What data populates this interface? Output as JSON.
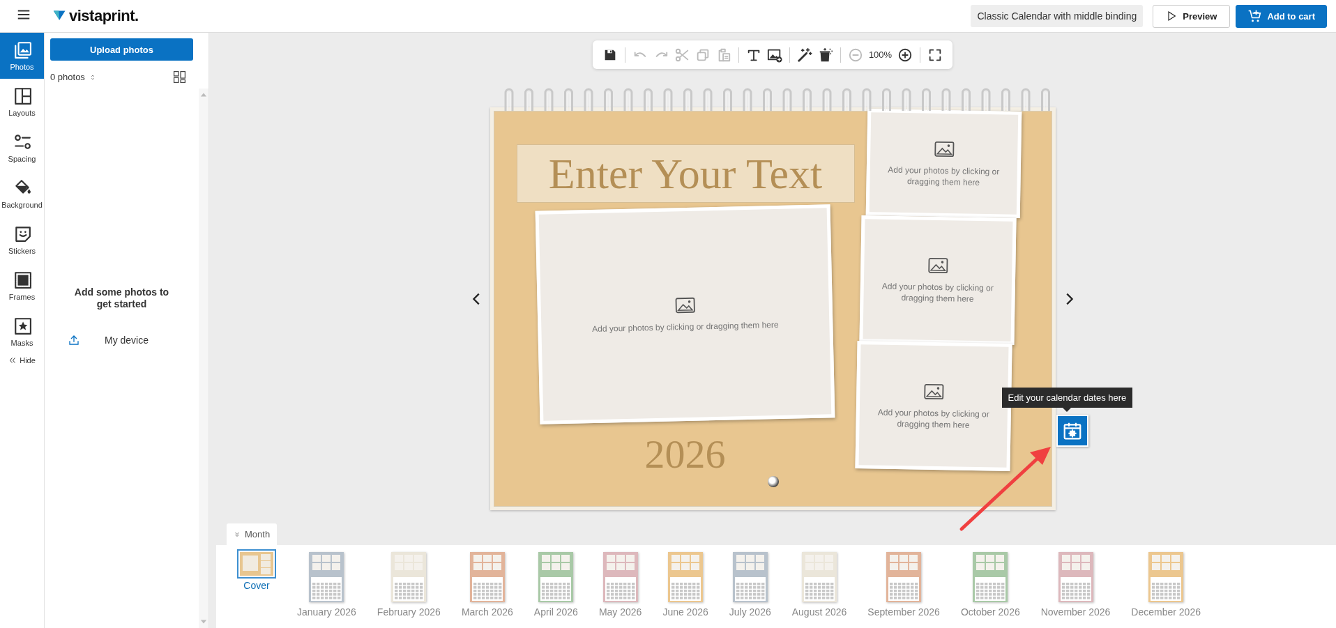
{
  "header": {
    "logo": "vistaprint.",
    "product_name": "Classic Calendar with middle binding",
    "buttons": [
      {
        "label": "Preview",
        "kind": "secondary"
      },
      {
        "label": "Add to cart",
        "kind": "primary"
      }
    ]
  },
  "rail": {
    "items": [
      {
        "label": "Photos",
        "kind": "photos",
        "selected": true
      },
      {
        "label": "Layouts",
        "kind": "layouts",
        "selected": false
      },
      {
        "label": "Spacing",
        "kind": "spacing",
        "selected": false
      },
      {
        "label": "Background",
        "kind": "background",
        "selected": false
      },
      {
        "label": "Stickers",
        "kind": "stickers",
        "selected": false
      },
      {
        "label": "Frames",
        "kind": "frames",
        "selected": false
      },
      {
        "label": "Masks",
        "kind": "masks",
        "selected": false
      }
    ],
    "hide": "Hide"
  },
  "panel": {
    "upload_button": "Upload photos",
    "photo_count": "0 photos",
    "empty_message": "Add some photos to get started",
    "source": "My device"
  },
  "toolbar": {
    "items": [
      {
        "kind": "save",
        "disabled": false
      },
      {
        "kind": "separator"
      },
      {
        "kind": "undo",
        "disabled": true
      },
      {
        "kind": "redo",
        "disabled": true
      },
      {
        "kind": "cut",
        "disabled": true
      },
      {
        "kind": "copy",
        "disabled": true
      },
      {
        "kind": "paste",
        "disabled": true
      },
      {
        "kind": "separator"
      },
      {
        "kind": "text",
        "disabled": false
      },
      {
        "kind": "add-image",
        "disabled": false
      },
      {
        "kind": "separator"
      },
      {
        "kind": "magic",
        "disabled": false
      },
      {
        "kind": "delete",
        "disabled": false
      },
      {
        "kind": "separator"
      },
      {
        "kind": "zoom-out",
        "disabled": true
      },
      {
        "kind": "zoom-level",
        "label": "100%"
      },
      {
        "kind": "zoom-in",
        "disabled": false
      },
      {
        "kind": "separator"
      },
      {
        "kind": "fullscreen",
        "disabled": false
      }
    ]
  },
  "canvas": {
    "title_placeholder": "Enter Your Text",
    "year": "2026",
    "photo_slots": [
      {
        "text": "Add your photos by clicking or dragging them here"
      },
      {
        "text": "Add your photos by clicking or dragging them here"
      },
      {
        "text": "Add your photos by clicking or dragging them here"
      },
      {
        "text": "Add your photos by clicking or dragging them here"
      }
    ],
    "tooltip": "Edit your calendar dates here"
  },
  "pages": {
    "tab": "Month",
    "items": [
      {
        "label": "Cover",
        "selected": true,
        "kind": "cover",
        "color": "#e8c690"
      },
      {
        "label": "January 2026",
        "selected": false,
        "kind": "month",
        "color": "#b8c2cc"
      },
      {
        "label": "February 2026",
        "selected": false,
        "kind": "month",
        "color": "#ebe6da"
      },
      {
        "label": "March 2026",
        "selected": false,
        "kind": "month",
        "color": "#e2b49a"
      },
      {
        "label": "April 2026",
        "selected": false,
        "kind": "month",
        "color": "#a9c9a7"
      },
      {
        "label": "May 2026",
        "selected": false,
        "kind": "month",
        "color": "#ddb8bc"
      },
      {
        "label": "June 2026",
        "selected": false,
        "kind": "month",
        "color": "#ecc78f"
      },
      {
        "label": "July 2026",
        "selected": false,
        "kind": "month",
        "color": "#b8c2cc"
      },
      {
        "label": "August 2026",
        "selected": false,
        "kind": "month",
        "color": "#ebe6da"
      },
      {
        "label": "September 2026",
        "selected": false,
        "kind": "month",
        "color": "#e2b49a"
      },
      {
        "label": "October 2026",
        "selected": false,
        "kind": "month",
        "color": "#a9c9a7"
      },
      {
        "label": "November 2026",
        "selected": false,
        "kind": "month",
        "color": "#ddb8bc"
      },
      {
        "label": "December 2026",
        "selected": false,
        "kind": "month",
        "color": "#ecc78f"
      }
    ]
  }
}
